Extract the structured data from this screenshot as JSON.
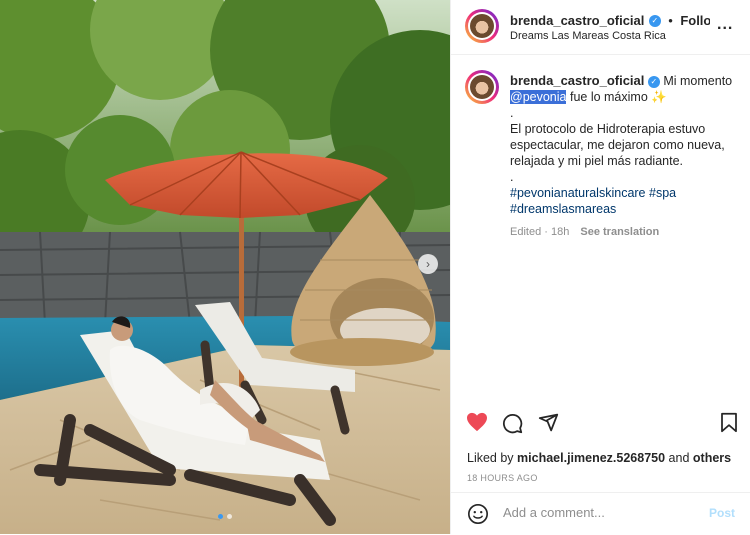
{
  "post": {
    "username": "brenda_castro_oficial",
    "follow_label": "Followi",
    "follow_sep": "•",
    "location": "Dreams Las Mareas Costa Rica",
    "more_label": "..."
  },
  "caption": {
    "username": "brenda_castro_oficial",
    "intro": "Mi momento",
    "mention": "@pevonia",
    "rest": "fue lo máximo",
    "sparkle": "✨",
    "dot1": ".",
    "body": "El protocolo de Hidroterapia estuvo espectacular, me dejaron como nueva, relajada y mi piel más radiante.",
    "dot2": ".",
    "tag1": "#pevonianaturalskincare",
    "tag2": "#spa",
    "tag3": "#dreamslasmareas"
  },
  "meta": {
    "edited": "Edited · 18h",
    "see_translation": "See translation"
  },
  "likes": {
    "prefix": "Liked by",
    "user": "michael.jimenez.5268750",
    "and": "and",
    "others": "others"
  },
  "timestamp": "18 HOURS AGO",
  "comment": {
    "placeholder": "Add a comment...",
    "post_label": "Post"
  },
  "icons": {
    "heart": "heart-icon",
    "comment": "comment-icon",
    "share": "share-icon",
    "save": "bookmark-icon",
    "emoji": "emoji-icon",
    "next": "chevron-right-icon"
  },
  "colors": {
    "heart": "#ed4956",
    "verified": "#3897f0",
    "hashtag": "#00376b",
    "mention_highlight": "#3b6fd8"
  }
}
